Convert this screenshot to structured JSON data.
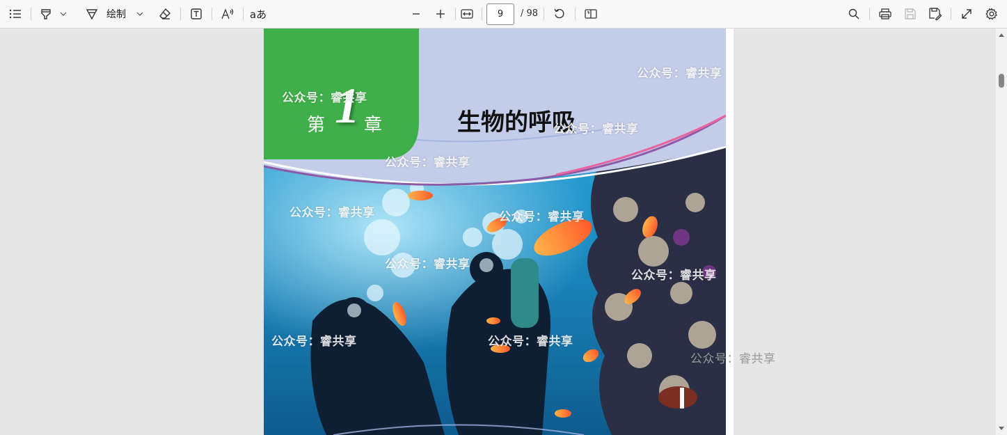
{
  "toolbar": {
    "draw_label": "绘制",
    "text_label_icon": "text-box-icon",
    "read_aloud_icon": "read-aloud-icon",
    "translate_label": "aあ",
    "current_page": "9",
    "total_pages": "/ 98"
  },
  "document": {
    "chapter_prefix": "第",
    "chapter_number": "1",
    "chapter_suffix": "章",
    "chapter_title": "生物的呼吸",
    "watermark_text": "公众号：睿共享"
  },
  "colors": {
    "toolbar_bg": "#f9f9f9",
    "viewer_bg": "#e6e6e6",
    "chapter_green": "#3faf4a",
    "header_lavender": "#c3cce8",
    "ocean_blue": "#1d8fc6"
  }
}
